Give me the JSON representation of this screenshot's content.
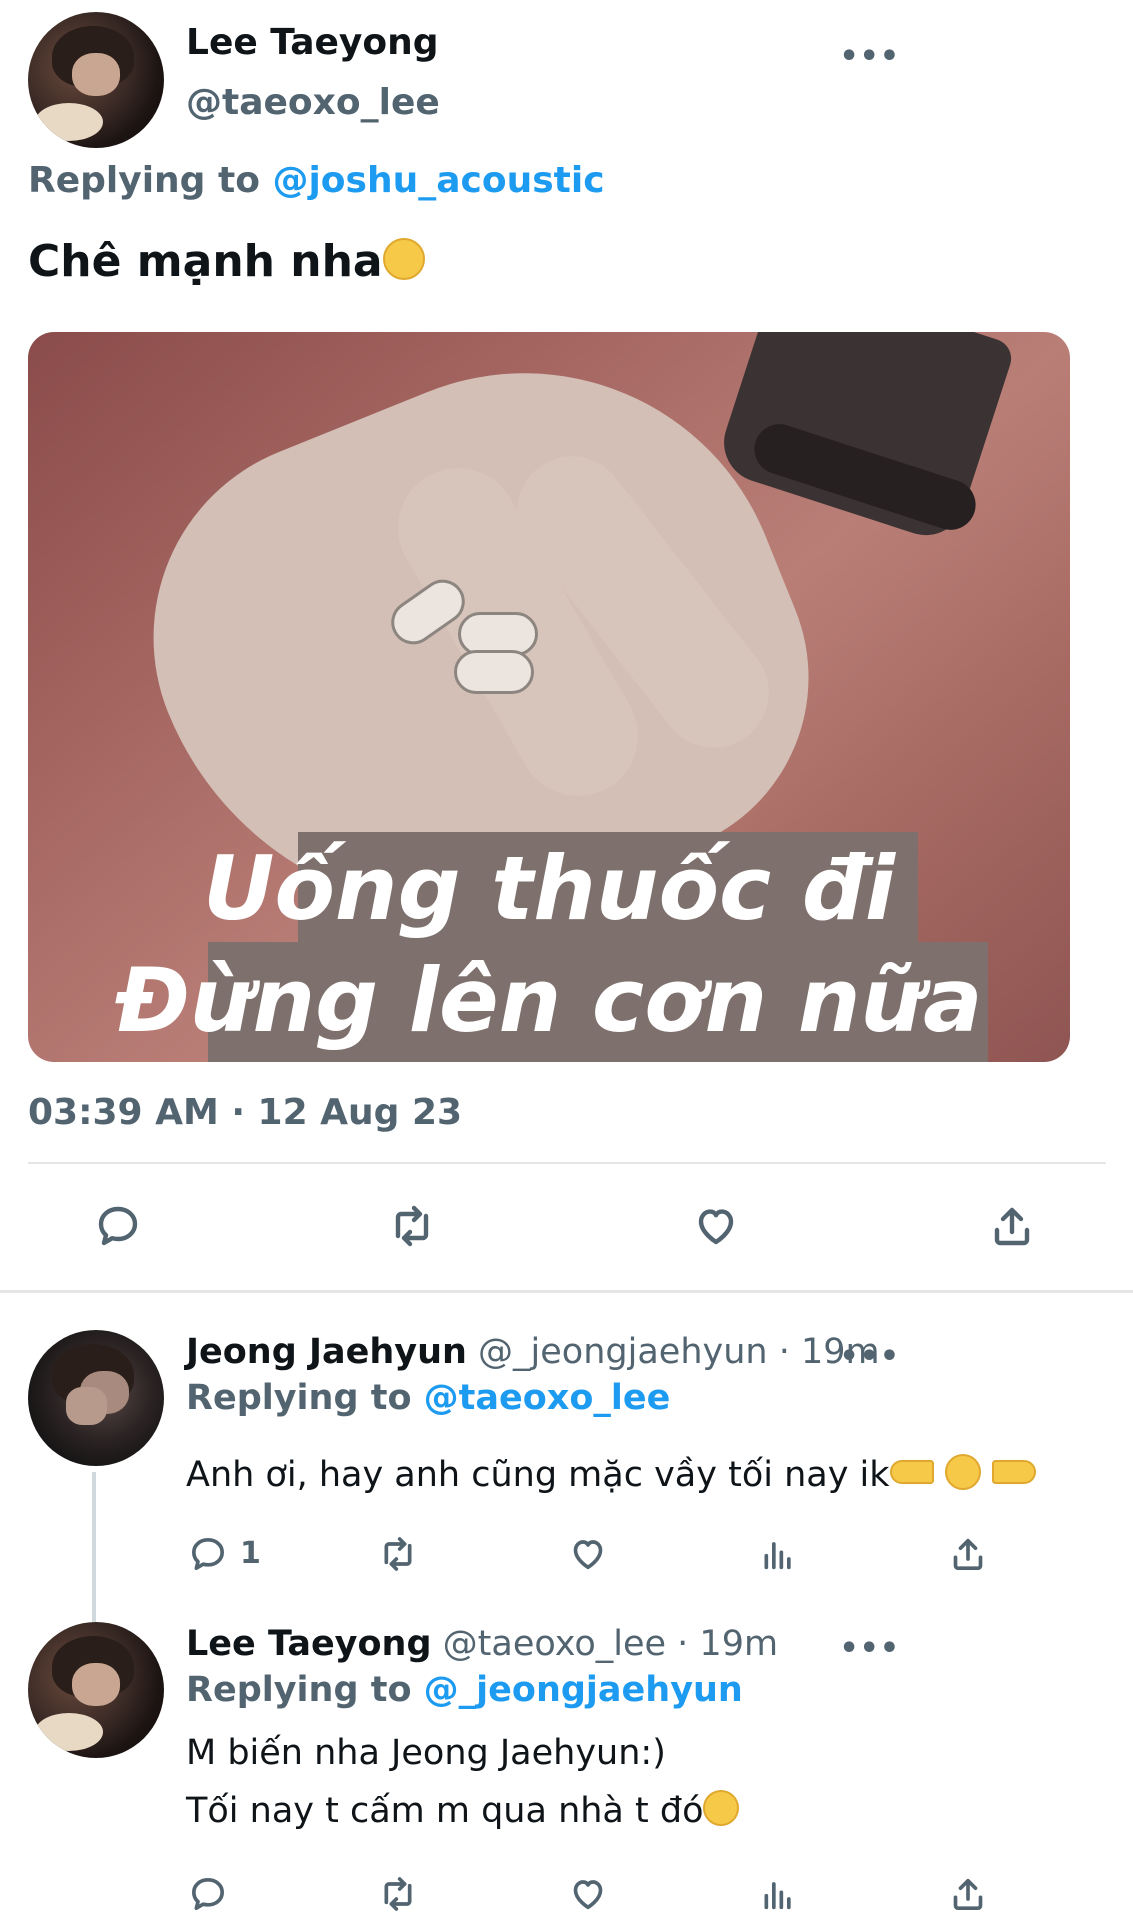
{
  "main_tweet": {
    "author_name": "Lee Taeyong",
    "author_handle": "@taeoxo_lee",
    "replying_prefix": "Replying to ",
    "replying_handle": "@joshu_acoustic",
    "text": "Chê mạnh nha",
    "text_emoji": "unamused-face",
    "media": {
      "caption_line1": "Uống thuốc đi",
      "caption_line2": "Đừng lên cơn nữa"
    },
    "timestamp": "03:39 AM · 12 Aug 23",
    "more_icon": "more-icon",
    "actions": [
      "reply-icon",
      "retweet-icon",
      "like-icon",
      "share-icon"
    ]
  },
  "replies": [
    {
      "author_name": "Jeong Jaehyun",
      "author_handle": "@_jeongjaehyun",
      "time": " · 19m",
      "replying_prefix": "Replying to ",
      "replying_handle": "@taeoxo_lee",
      "text": "Anh ơi, hay anh cũng mặc vầy tối nay ik",
      "reply_count": "1",
      "actions": [
        "reply-icon",
        "retweet-icon",
        "like-icon",
        "analytics-icon",
        "share-icon"
      ]
    },
    {
      "author_name": "Lee Taeyong",
      "author_handle": "@taeoxo_lee",
      "time": " · 19m",
      "replying_prefix": "Replying to ",
      "replying_handle": "@_jeongjaehyun",
      "text_line1": "M biến nha Jeong Jaehyun:)",
      "text_line2": "Tối nay t cấm m qua nhà t đó",
      "actions": [
        "reply-icon",
        "retweet-icon",
        "like-icon",
        "analytics-icon",
        "share-icon"
      ]
    }
  ],
  "colors": {
    "text": "#0f1419",
    "secondary": "#536471",
    "link": "#1d9bf0",
    "divider": "#e6e6e6"
  }
}
